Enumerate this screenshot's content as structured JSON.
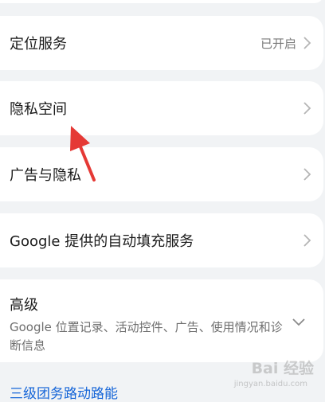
{
  "settings": {
    "items": [
      {
        "label": "定位服务",
        "value": "已开启"
      },
      {
        "label": "隐私空间",
        "value": ""
      },
      {
        "label": "广告与隐私",
        "value": ""
      },
      {
        "label": "Google 提供的自动填充服务",
        "value": ""
      }
    ],
    "advanced": {
      "title": "高级",
      "subtitle": "Google 位置记录、活动控件、广告、使用情况和诊断信息"
    },
    "bottom_link": "三级团务路动路能"
  },
  "watermark": {
    "text": "Bai 经验",
    "sub": "jingyan.baidu.com"
  },
  "colors": {
    "background": "#f1f3f5",
    "card": "#ffffff",
    "link": "#1565d8",
    "annotation_arrow": "#e53935"
  }
}
